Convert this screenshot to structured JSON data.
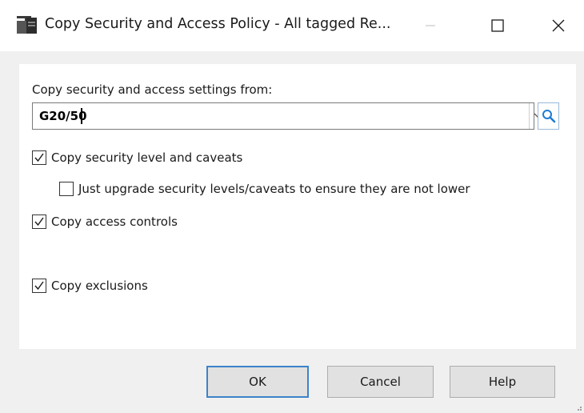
{
  "window": {
    "title": "Copy Security and Access Policy - All tagged Re..."
  },
  "form": {
    "from_label": "Copy security and access settings from:",
    "from_value": "G20/50"
  },
  "options": {
    "copy_security": {
      "label": "Copy security level and caveats",
      "checked": true
    },
    "just_upgrade": {
      "label": "Just upgrade security levels/caveats to ensure they are not lower",
      "checked": false
    },
    "copy_access": {
      "label": "Copy access controls",
      "checked": true
    },
    "copy_exclusions": {
      "label": "Copy exclusions",
      "checked": true
    }
  },
  "buttons": {
    "ok": "OK",
    "cancel": "Cancel",
    "help": "Help"
  },
  "icons": {
    "app": "policy-copy-icon",
    "minimize": "minimize-icon",
    "maximize": "maximize-icon",
    "close": "close-icon",
    "dropdown": "chevron-down-icon",
    "search": "search-icon",
    "check": "checkmark-icon"
  },
  "colors": {
    "accent": "#3c83c9",
    "search_icon": "#1f7ad4"
  }
}
